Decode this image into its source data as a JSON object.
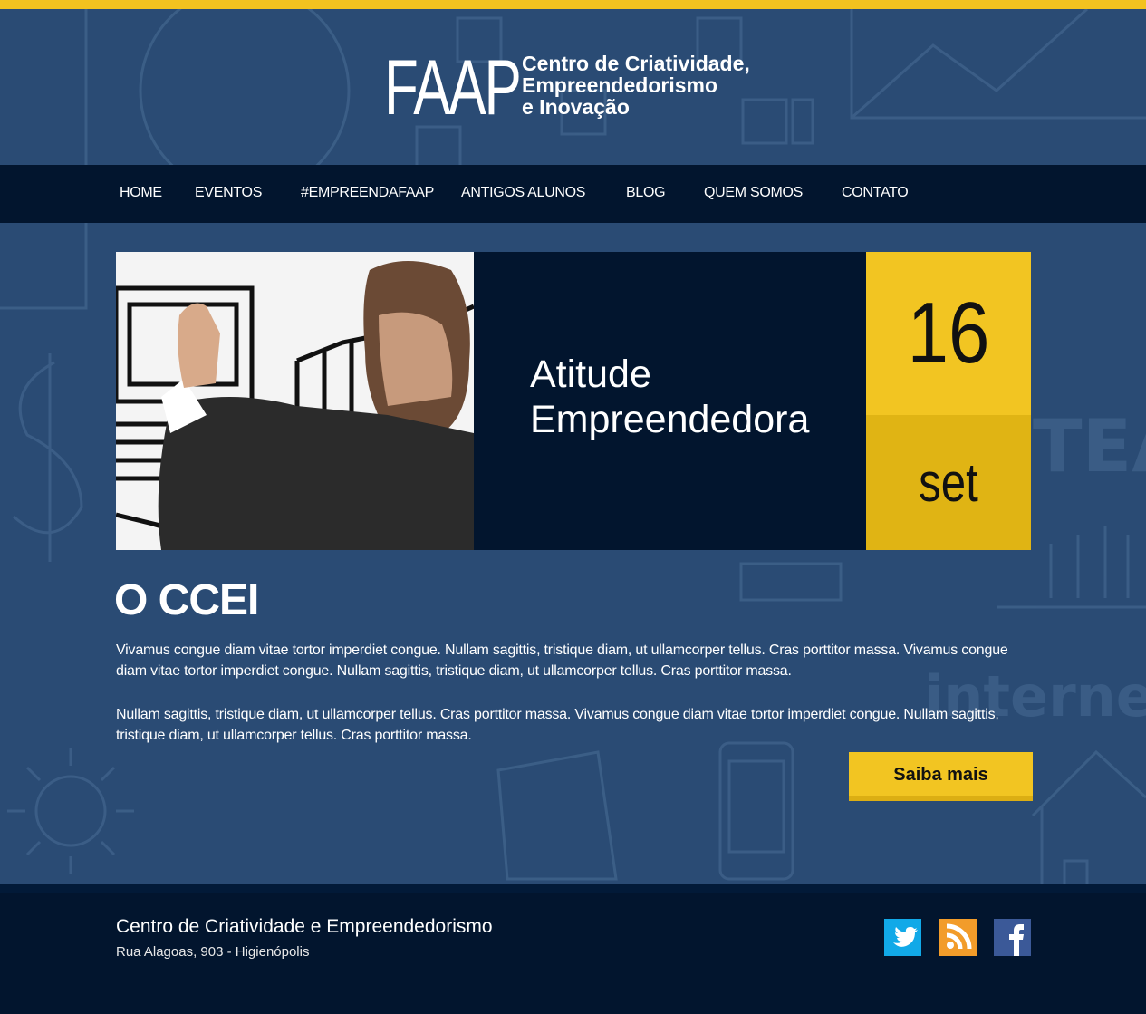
{
  "header": {
    "logo_main": "FAAP",
    "logo_line1": "Centro de Criatividade,",
    "logo_line2": "Empreendedorismo",
    "logo_line3": "e Inovação"
  },
  "nav": {
    "items": [
      {
        "label": "HOME"
      },
      {
        "label": "EVENTOS"
      },
      {
        "label": "#EMPREENDAFAAP"
      },
      {
        "label": "ANTIGOS ALUNOS"
      },
      {
        "label": "BLOG"
      },
      {
        "label": "QUEM SOMOS"
      },
      {
        "label": "CONTATO"
      }
    ]
  },
  "hero": {
    "title_line1": "Atitude",
    "title_line2": "Empreendedora",
    "day": "16",
    "month": "set"
  },
  "about": {
    "title": "O CCEI",
    "paragraph1": "Vivamus congue diam vitae tortor imperdiet congue. Nullam sagittis, tristique diam, ut ullamcorper tellus. Cras porttitor massa. Vivamus congue diam vitae tortor imperdiet congue. Nullam sagittis, tristique diam, ut ullamcorper tellus. Cras porttitor massa.",
    "paragraph2": "Nullam sagittis, tristique diam, ut ullamcorper tellus. Cras porttitor massa. Vivamus congue diam vitae tortor imperdiet congue. Nullam sagittis, tristique diam, ut ullamcorper tellus. Cras porttitor massa.",
    "button_label": "Saiba mais"
  },
  "footer": {
    "title": "Centro de Criatividade e Empreendedorismo",
    "address": "Rua Alagoas, 903 - Higienópolis",
    "social": [
      {
        "icon": "twitter-icon",
        "color": "#11a9e8"
      },
      {
        "icon": "rss-icon",
        "color": "#f29c2a"
      },
      {
        "icon": "facebook-icon",
        "color": "#3b5998"
      }
    ]
  },
  "colors": {
    "accent": "#f2c522",
    "background": "#2a4b74",
    "dark": "#02152e"
  }
}
